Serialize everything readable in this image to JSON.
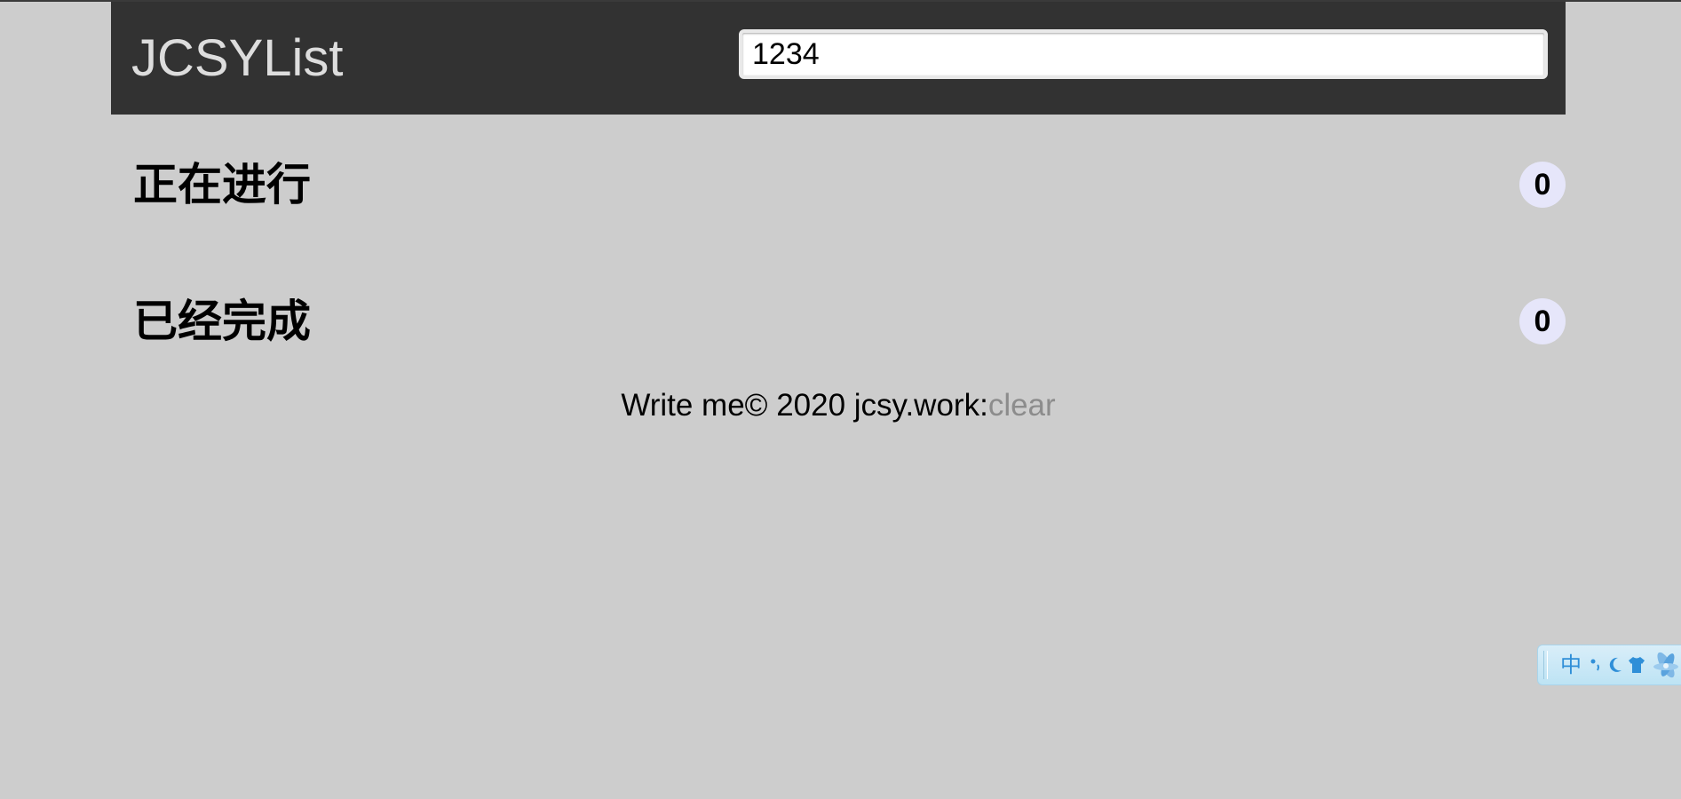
{
  "app": {
    "title": "JCSYList"
  },
  "todo_input": {
    "value": "1234",
    "placeholder": ""
  },
  "sections": {
    "ongoing": {
      "title": "正在进行",
      "count": "0"
    },
    "done": {
      "title": "已经完成",
      "count": "0"
    }
  },
  "footer": {
    "text": "Write me© 2020 jcsy.work:",
    "clear_label": "clear"
  },
  "ime": {
    "language": "中",
    "icons": [
      "punctuation-icon",
      "moon-icon",
      "shirt-icon",
      "flower-icon"
    ]
  },
  "colors": {
    "header_bg": "#323232",
    "page_bg": "#cdcdcd",
    "badge_bg": "#e6e6fa",
    "link_gray": "#8c8c8c"
  }
}
